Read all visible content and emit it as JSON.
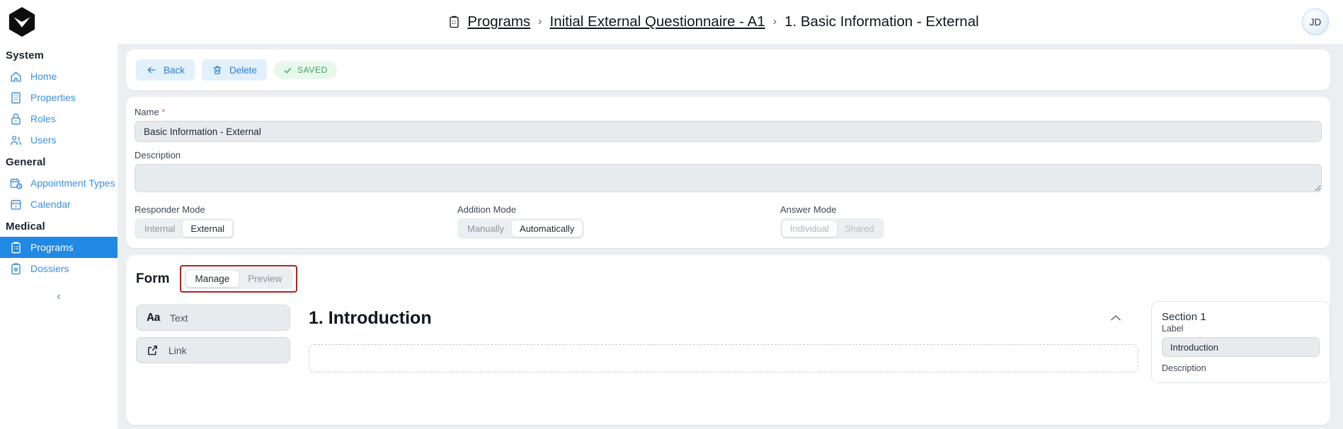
{
  "sidebar": {
    "logo_icon": "hexagon-logo-icon",
    "groups": [
      {
        "title": "System",
        "items": [
          {
            "label": "Home",
            "icon": "home-icon",
            "active": false
          },
          {
            "label": "Properties",
            "icon": "building-icon",
            "active": false
          },
          {
            "label": "Roles",
            "icon": "lock-icon",
            "active": false
          },
          {
            "label": "Users",
            "icon": "users-icon",
            "active": false
          }
        ]
      },
      {
        "title": "General",
        "items": [
          {
            "label": "Appointment Types",
            "icon": "calendar-clock-icon",
            "active": false
          },
          {
            "label": "Calendar",
            "icon": "calendar-icon",
            "active": false
          }
        ]
      },
      {
        "title": "Medical",
        "items": [
          {
            "label": "Programs",
            "icon": "clipboard-list-icon",
            "active": true
          },
          {
            "label": "Dossiers",
            "icon": "clipboard-heart-icon",
            "active": false
          }
        ]
      }
    ],
    "collapse_label": "‹",
    "active_color": "#2089e4",
    "link_color": "#3b8fe0"
  },
  "topbar": {
    "breadcrumb": {
      "icon": "clipboard-icon",
      "items": [
        {
          "label": "Programs",
          "link": true
        },
        {
          "label": "Initial External Questionnaire - A1",
          "link": true
        },
        {
          "label": "1. Basic Information - External",
          "link": false
        }
      ],
      "separator": "›"
    },
    "avatar_initials": "JD"
  },
  "toolbar": {
    "back_label": "Back",
    "delete_label": "Delete",
    "saved_label": "SAVED",
    "saved_color": "#3aa45c"
  },
  "form": {
    "name_label": "Name",
    "name_required_mark": "*",
    "name_value": "Basic Information - External",
    "description_label": "Description",
    "description_value": "",
    "modes": [
      {
        "label": "Responder Mode",
        "options": [
          "Internal",
          "External"
        ],
        "selected": "External",
        "disabled": false
      },
      {
        "label": "Addition Mode",
        "options": [
          "Manually",
          "Automatically"
        ],
        "selected": "Automatically",
        "disabled": false
      },
      {
        "label": "Answer Mode",
        "options": [
          "Individual",
          "Shared"
        ],
        "selected": "Individual",
        "disabled": true
      }
    ]
  },
  "builder": {
    "title": "Form",
    "tabs": [
      {
        "label": "Manage",
        "selected": true
      },
      {
        "label": "Preview",
        "selected": false
      }
    ],
    "highlight_color": "#b32121",
    "palette": [
      {
        "label": "Text",
        "icon": "text-aa-icon",
        "glyph": "Aa"
      },
      {
        "label": "Link",
        "icon": "external-link-icon"
      }
    ],
    "section": {
      "heading": "1. Introduction",
      "collapse_icon": "chevron-up-icon"
    },
    "inspector": {
      "title": "Section 1",
      "label_caption": "Label",
      "label_value": "Introduction",
      "description_caption": "Description"
    }
  }
}
